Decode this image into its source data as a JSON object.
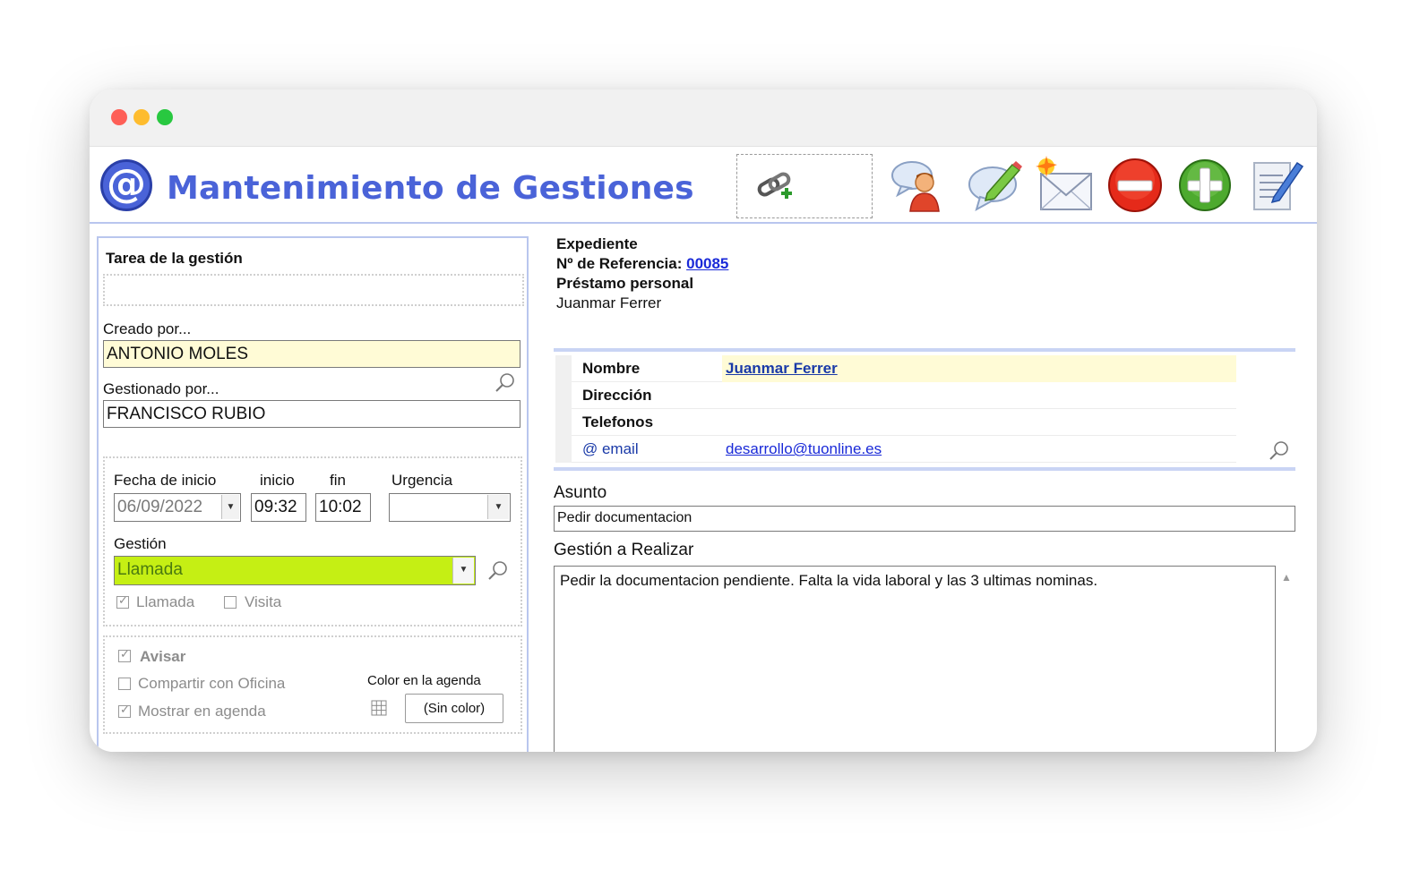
{
  "header": {
    "logo_glyph": "@",
    "title": "Mantenimiento de Gestiones",
    "icons": [
      "add-link-icon",
      "contact-person-icon",
      "edit-comment-icon",
      "new-mail-icon",
      "delete-icon",
      "add-icon",
      "notes-icon"
    ]
  },
  "left": {
    "task_label": "Tarea de la gestión",
    "created_by_label": "Creado por...",
    "created_by_value": "ANTONIO MOLES",
    "managed_by_label": "Gestionado por...",
    "managed_by_value": "FRANCISCO RUBIO",
    "start_date_label": "Fecha de inicio",
    "start_date_value": "06/09/2022",
    "start_time_label": "inicio",
    "start_time_value": "09:32",
    "end_time_label": "fin",
    "end_time_value": "10:02",
    "urgency_label": "Urgencia",
    "urgency_value": "",
    "gestion_label": "Gestión",
    "gestion_value": "Llamada",
    "gestion_color": "#c5ef14",
    "checkbox_call": "Llamada",
    "checkbox_call_checked": true,
    "checkbox_visit": "Visita",
    "checkbox_visit_checked": false,
    "notify_label": "Avisar",
    "notify_checked": true,
    "share_label": "Compartir con Oficina",
    "share_checked": false,
    "show_agenda_label": "Mostrar en agenda",
    "show_agenda_checked": true,
    "agenda_color_label": "Color en la agenda",
    "agenda_color_button": "(Sin color)"
  },
  "expediente": {
    "heading": "Expediente",
    "ref_label": "Nº de Referencia:",
    "ref_value": "00085",
    "type": "Préstamo personal",
    "client": "Juanmar Ferrer"
  },
  "contact": {
    "rows": [
      {
        "label": "Nombre",
        "value": "Juanmar Ferrer"
      },
      {
        "label": "Dirección",
        "value": ""
      },
      {
        "label": "Telefonos",
        "value": ""
      },
      {
        "label": "@ email",
        "value": "desarrollo@tuonline.es"
      }
    ]
  },
  "subject": {
    "label": "Asunto",
    "value": "Pedir documentacion"
  },
  "task": {
    "label": "Gestión a Realizar",
    "value": "Pedir la documentacion pendiente. Falta la vida laboral y las 3 ultimas nominas."
  }
}
